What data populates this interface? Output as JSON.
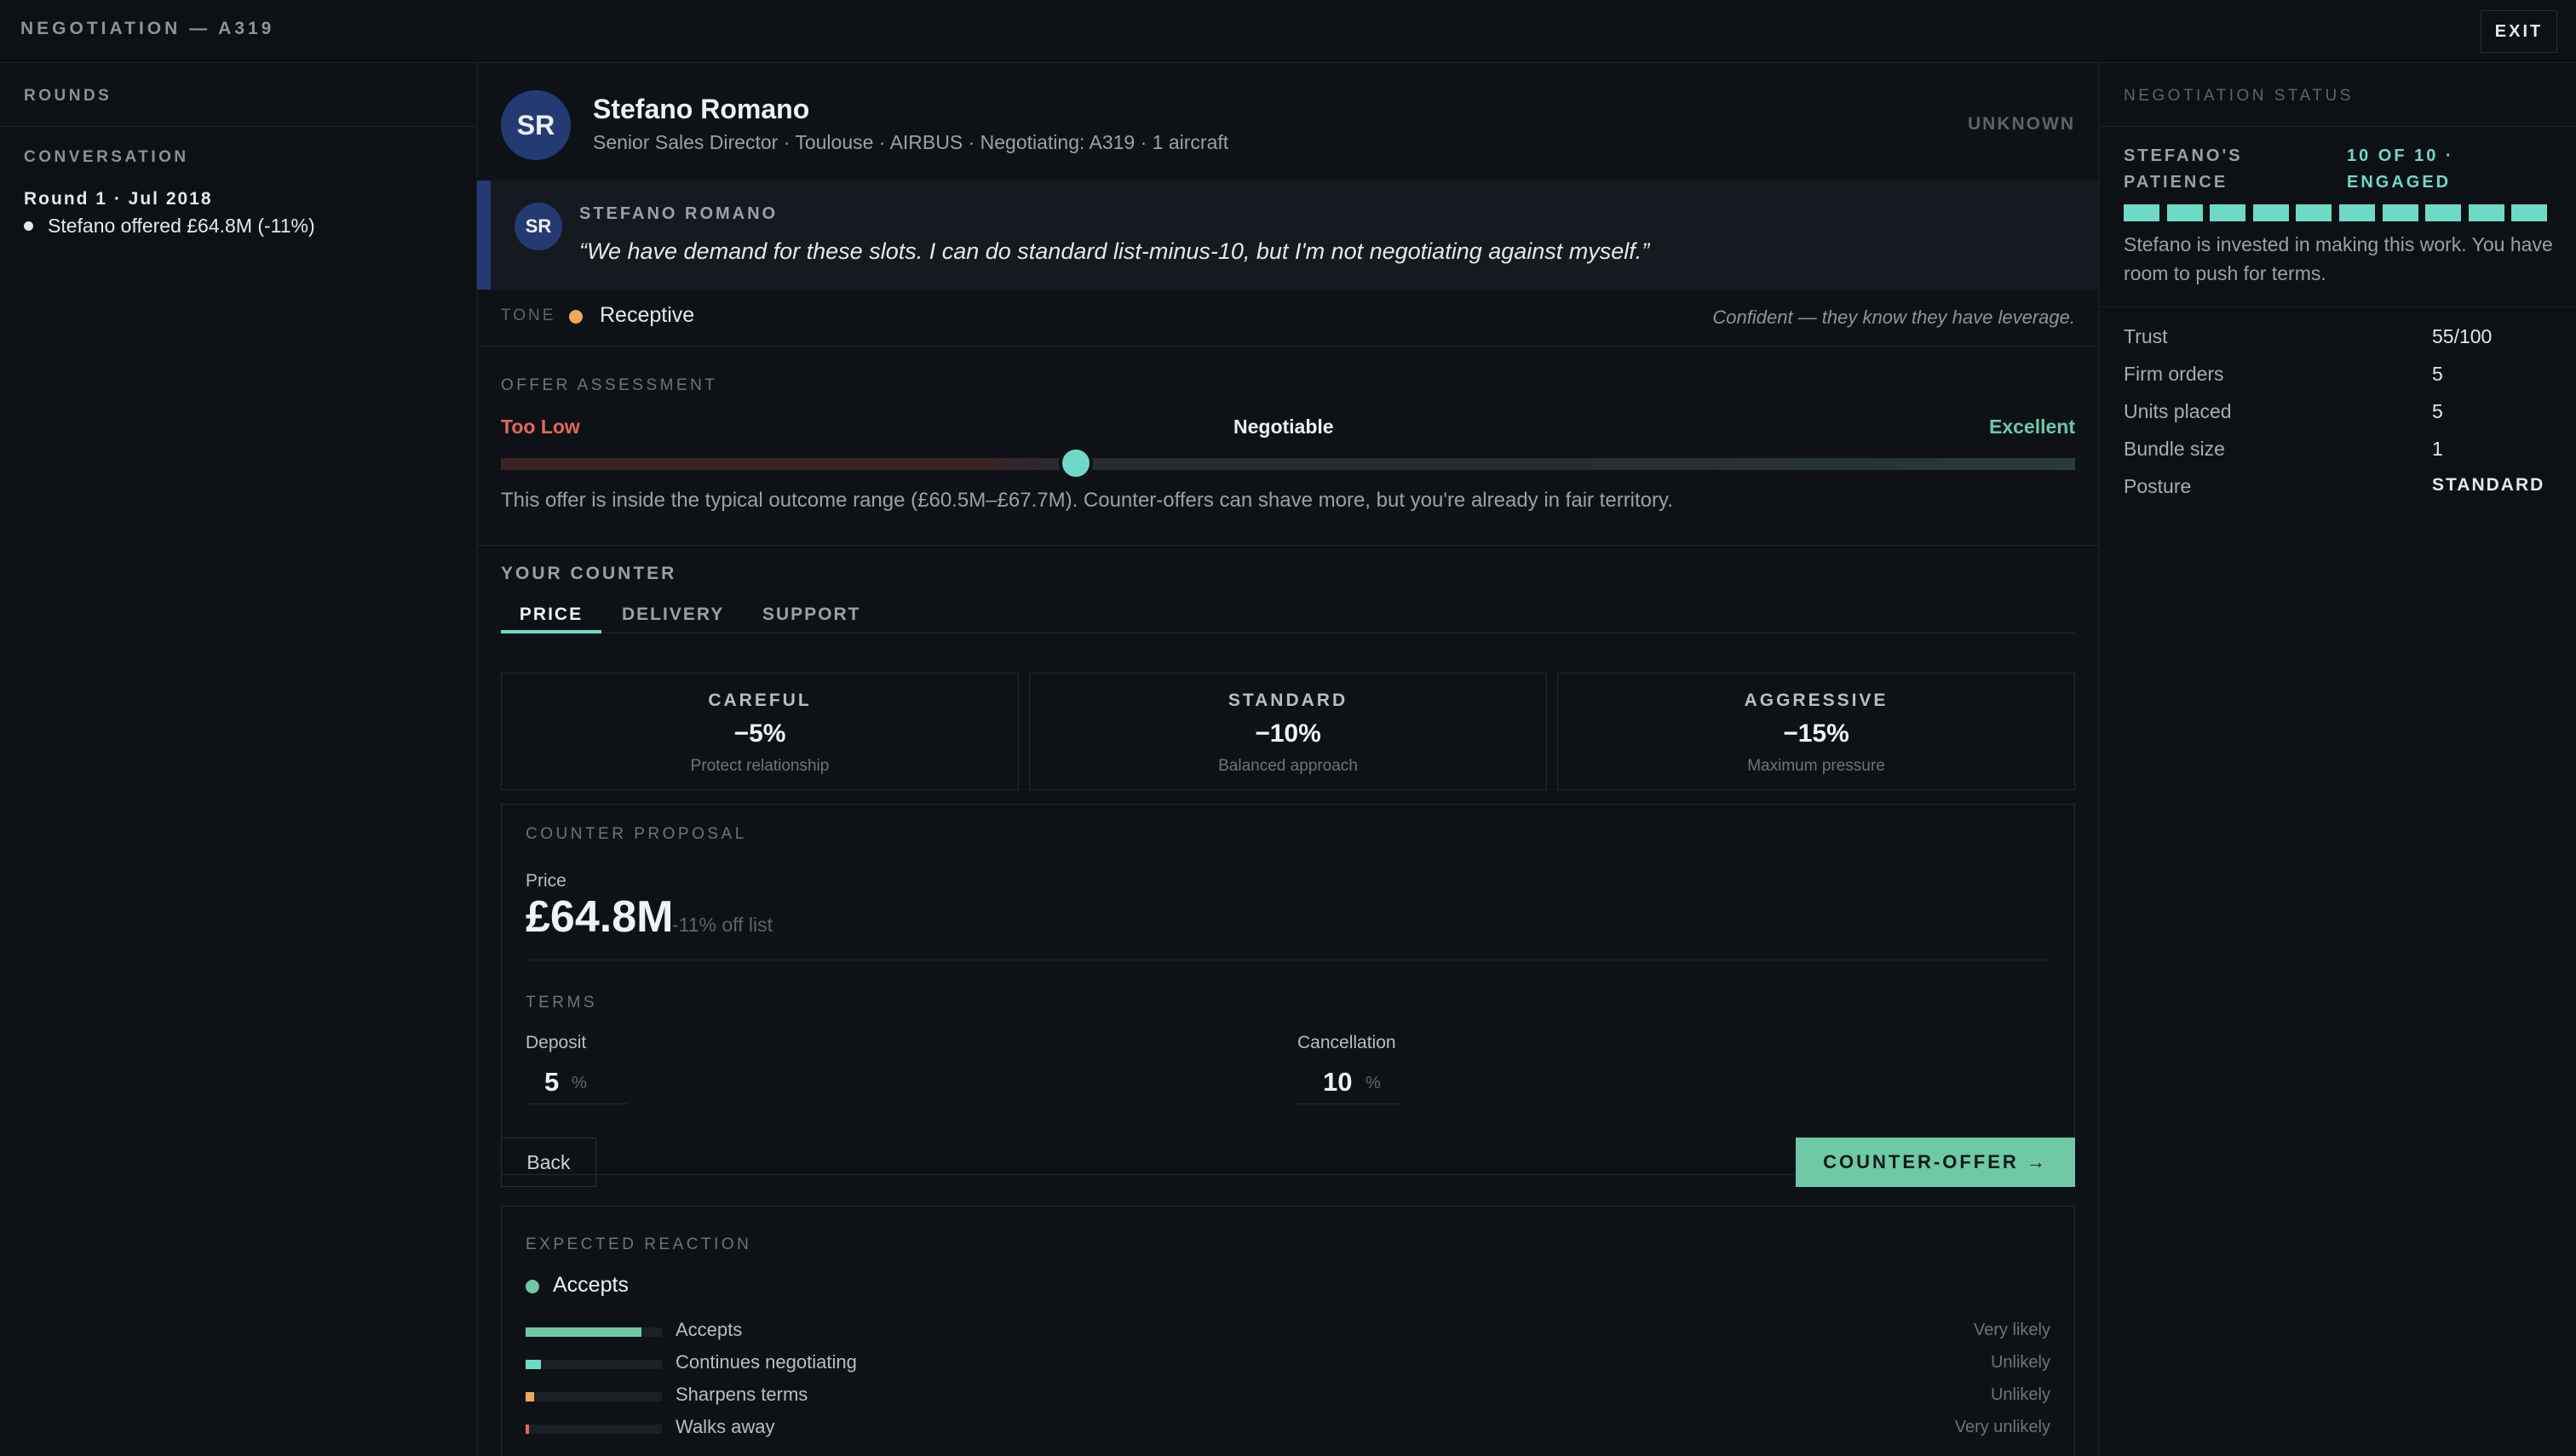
{
  "header": {
    "title": "NEGOTIATION — A319",
    "exit_label": "EXIT"
  },
  "sidebar": {
    "rounds_label": "ROUNDS",
    "conversation_label": "CONVERSATION",
    "round_title": "Round 1 · Jul 2018",
    "round_entry": "Stefano offered £64.8M (-11%)"
  },
  "contact": {
    "initials": "SR",
    "name": "Stefano Romano",
    "subtitle": "Senior Sales Director · Toulouse · AIRBUS · Negotiating: A319 · 1 aircraft",
    "status": "UNKNOWN"
  },
  "message": {
    "speaker": "STEFANO ROMANO",
    "text": "“We have demand for these slots. I can do standard list-minus-10, but I'm not negotiating against myself.”"
  },
  "tone": {
    "label": "TONE",
    "value": "Receptive",
    "note": "Confident — they know they have leverage.",
    "dot_color": "#f0a85a"
  },
  "assessment": {
    "label": "OFFER ASSESSMENT",
    "low": "Too Low",
    "mid": "Negotiable",
    "high": "Excellent",
    "position": 0.365,
    "text": "This offer is inside the typical outcome range (£60.5M–£67.7M). Counter-offers can shave more, but you're already in fair territory.",
    "colors": {
      "low": "#e5675a",
      "high": "#6fc9a6"
    }
  },
  "counter": {
    "label": "YOUR COUNTER",
    "tabs": [
      "PRICE",
      "DELIVERY",
      "SUPPORT"
    ],
    "active_tab": "PRICE",
    "options": [
      {
        "name": "CAREFUL",
        "value": "−5%",
        "desc": "Protect relationship"
      },
      {
        "name": "STANDARD",
        "value": "−10%",
        "desc": "Balanced approach"
      },
      {
        "name": "AGGRESSIVE",
        "value": "−15%",
        "desc": "Maximum pressure"
      }
    ],
    "proposal_label": "COUNTER PROPOSAL",
    "price_label": "Price",
    "price_value": "£64.8M",
    "price_note": "-11% off list",
    "terms_label": "TERMS",
    "deposit_label": "Deposit",
    "deposit_value": "5",
    "cancellation_label": "Cancellation",
    "cancellation_value": "10",
    "percent": "%",
    "back_label": "Back",
    "counter_label": "COUNTER-OFFER →"
  },
  "reaction": {
    "label": "EXPECTED REACTION",
    "headline": "Accepts",
    "rows": [
      {
        "label": "Accepts",
        "likelihood": "Very likely",
        "level": 0.85,
        "color": "#6fc9a6"
      },
      {
        "label": "Continues negotiating",
        "likelihood": "Unlikely",
        "level": 0.11,
        "color": "#6fd9c7"
      },
      {
        "label": "Sharpens terms",
        "likelihood": "Unlikely",
        "level": 0.06,
        "color": "#f0a85a"
      },
      {
        "label": "Walks away",
        "likelihood": "Very unlikely",
        "level": 0.02,
        "color": "#e5675a"
      }
    ]
  },
  "status": {
    "label": "NEGOTIATION STATUS",
    "patience_label": "STEFANO'S PATIENCE",
    "patience_value": "10 OF 10 · ENGAGED",
    "patience_level": 10,
    "patience_max": 10,
    "patience_text": "Stefano is invested in making this work. You have room to push for terms.",
    "stats": [
      {
        "label": "Trust",
        "value": "55/100"
      },
      {
        "label": "Firm orders",
        "value": "5"
      },
      {
        "label": "Units placed",
        "value": "5"
      },
      {
        "label": "Bundle size",
        "value": "1"
      },
      {
        "label": "Posture",
        "value": "STANDARD"
      }
    ]
  }
}
